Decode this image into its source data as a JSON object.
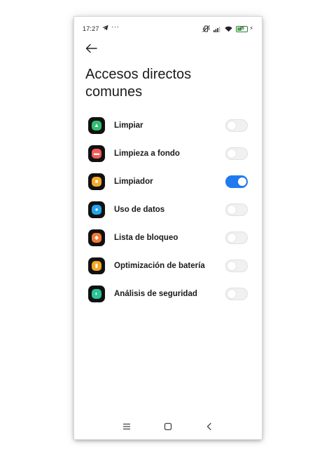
{
  "status_bar": {
    "time": "17:27",
    "telegram_icon": "telegram-send-icon",
    "dots": "···",
    "battery_level": "29",
    "battery_color": "#4caf50"
  },
  "header": {
    "back_icon": "arrow-left-icon",
    "title": "Accesos directos comunes"
  },
  "accent_color": "#1f7aef",
  "items": [
    {
      "label": "Limpiar",
      "icon": "broom-icon",
      "icon_color": "#2fbf71",
      "enabled": false
    },
    {
      "label": "Limpieza a fondo",
      "icon": "deep-clean-icon",
      "icon_color": "#f25b5b",
      "enabled": false
    },
    {
      "label": "Limpiador",
      "icon": "cleaner-icon",
      "icon_color": "#f7a928",
      "enabled": true
    },
    {
      "label": "Uso de datos",
      "icon": "data-drop-icon",
      "icon_color": "#22a4f0",
      "enabled": false
    },
    {
      "label": "Lista de bloqueo",
      "icon": "shield-block-icon",
      "icon_color": "#f47a36",
      "enabled": false
    },
    {
      "label": "Optimización de batería",
      "icon": "battery-icon",
      "icon_color": "#f5a623",
      "enabled": false
    },
    {
      "label": "Análisis de seguridad",
      "icon": "security-scan-icon",
      "icon_color": "#2bc49a",
      "enabled": false
    }
  ],
  "nav_bar": {
    "menu_icon": "menu-icon",
    "home_icon": "home-square-icon",
    "back_icon": "back-chevron-icon"
  }
}
